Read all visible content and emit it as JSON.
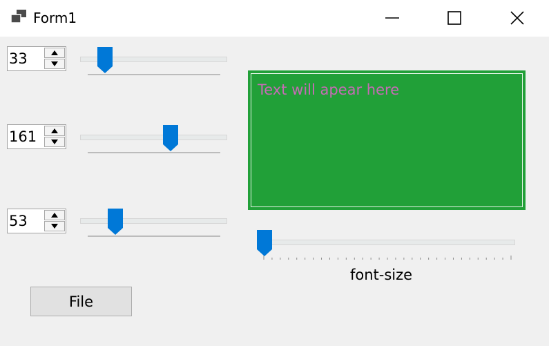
{
  "window": {
    "title": "Form1",
    "icon": "app-window-icon",
    "controls": [
      "minimize-icon",
      "maximize-icon",
      "close-icon"
    ]
  },
  "color_sliders": [
    {
      "value": "33",
      "fraction": 0.13
    },
    {
      "value": "161",
      "fraction": 0.63
    },
    {
      "value": "53",
      "fraction": 0.21
    }
  ],
  "text_panel": {
    "placeholder": "Text will apear here",
    "background_color": "#21a038",
    "text_color": "#c76bb6"
  },
  "font_size_slider": {
    "label": "font-size",
    "fraction": 0.0,
    "tick_count": 31
  },
  "file_button": {
    "label": "File"
  },
  "colors": {
    "accent": "#0078d7",
    "track": "#e7eaea",
    "window_bg": "#f0f0f0"
  }
}
